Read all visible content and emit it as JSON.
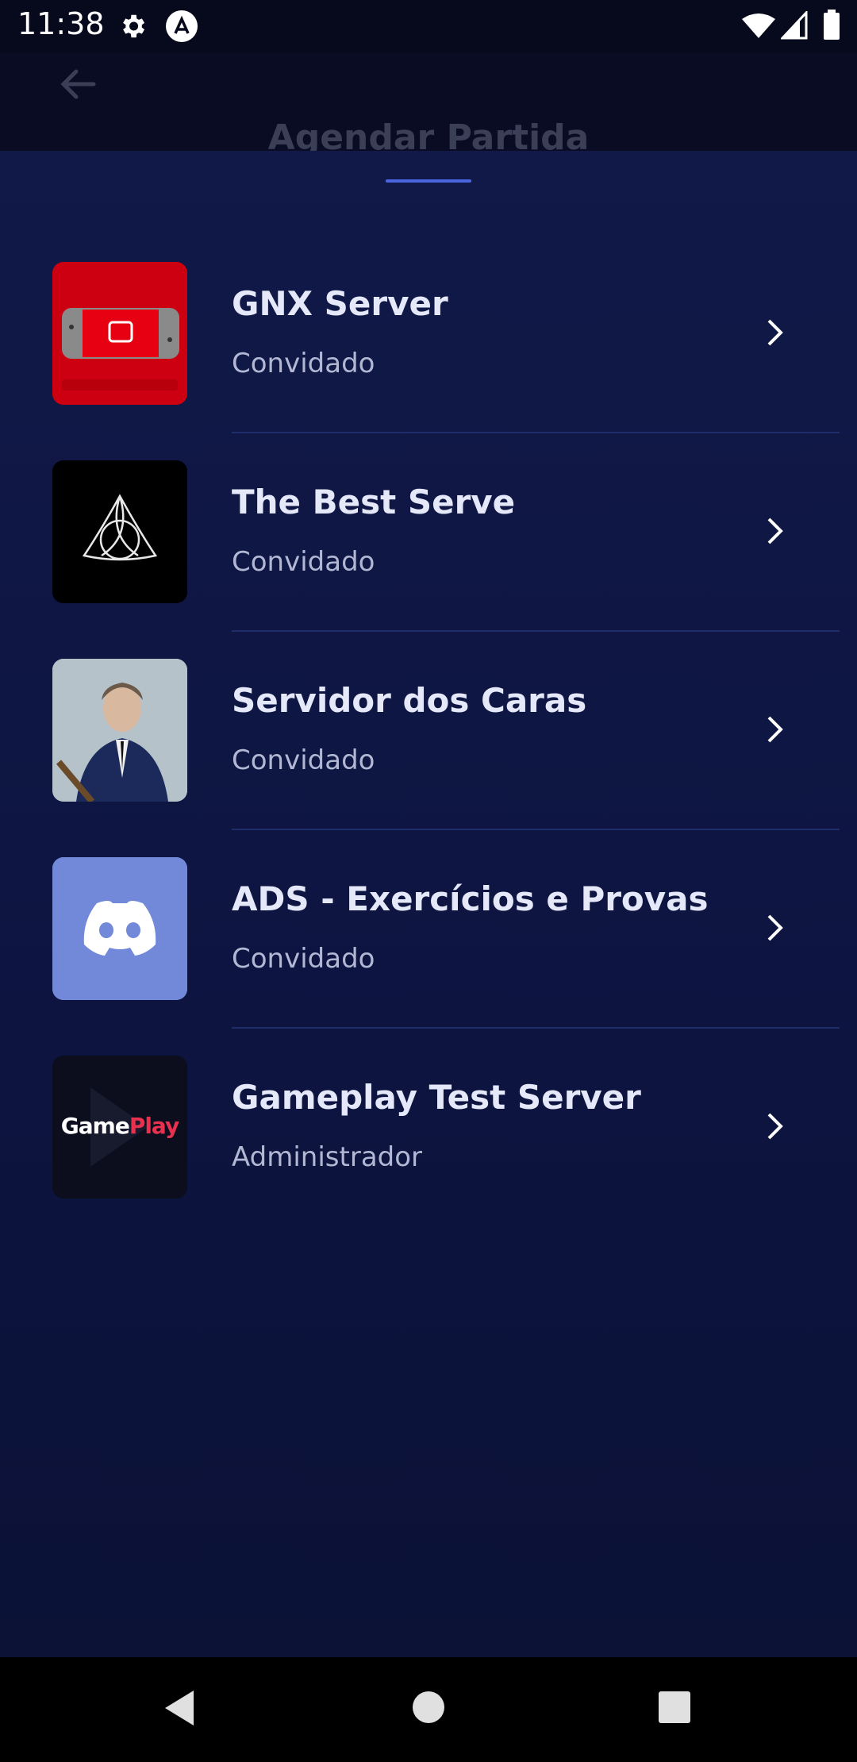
{
  "status_bar": {
    "time": "11:38"
  },
  "header": {
    "title": "Agendar Partida"
  },
  "servers": [
    {
      "name": "GNX Server",
      "role": "Convidado",
      "icon": "nintendo-switch-icon",
      "thumb_text": ""
    },
    {
      "name": "The Best Serve",
      "role": "Convidado",
      "icon": "triquetra-icon",
      "thumb_text": ""
    },
    {
      "name": "Servidor dos Caras",
      "role": "Convidado",
      "icon": "portrait-photo",
      "thumb_text": ""
    },
    {
      "name": "ADS - Exercícios e Provas",
      "role": "Convidado",
      "icon": "discord-icon",
      "thumb_text": ""
    },
    {
      "name": "Gameplay Test Server",
      "role": "Administrador",
      "icon": "gameplay-logo",
      "thumb_text": "GamePlay"
    }
  ],
  "colors": {
    "background": "#0a0d26",
    "sheet": "#111948",
    "accent": "#4b66e0",
    "discord": "#7289da",
    "switch_red": "#e60012"
  }
}
